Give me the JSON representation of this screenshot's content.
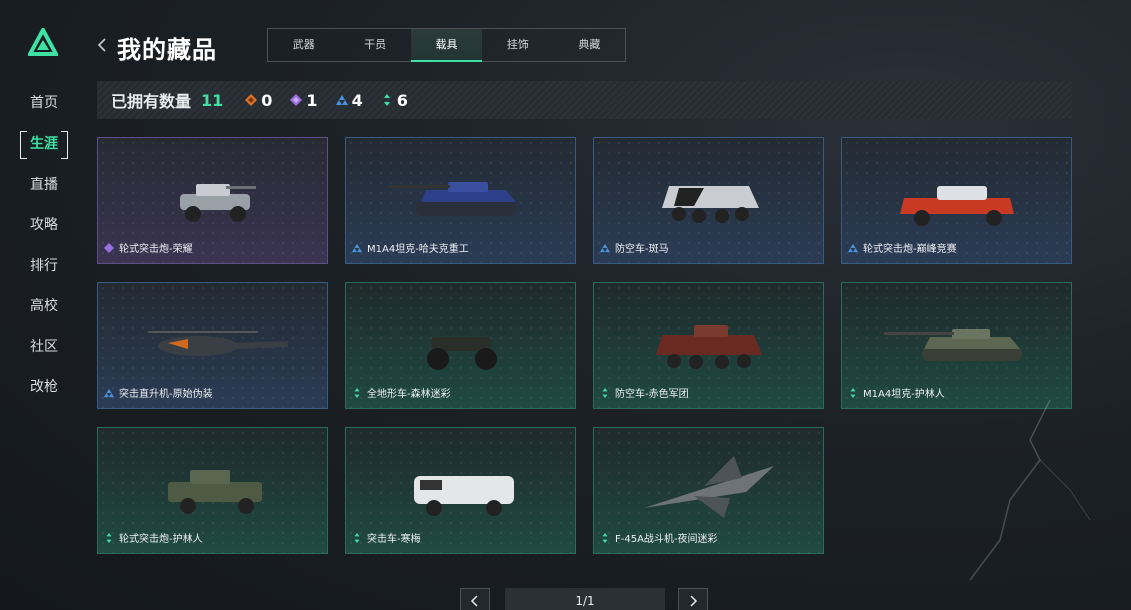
{
  "sidebar": {
    "items": [
      {
        "label": "首页",
        "active": false
      },
      {
        "label": "生涯",
        "active": true
      },
      {
        "label": "直播",
        "active": false
      },
      {
        "label": "攻略",
        "active": false
      },
      {
        "label": "排行",
        "active": false
      },
      {
        "label": "高校",
        "active": false
      },
      {
        "label": "社区",
        "active": false
      },
      {
        "label": "改枪",
        "active": false
      }
    ]
  },
  "header": {
    "back_icon": "chevron-left-icon",
    "title": "我的藏品",
    "tabs": [
      {
        "label": "武器",
        "active": false
      },
      {
        "label": "干员",
        "active": false
      },
      {
        "label": "载具",
        "active": true
      },
      {
        "label": "挂饰",
        "active": false
      },
      {
        "label": "典藏",
        "active": false
      }
    ]
  },
  "stats": {
    "label": "已拥有数量",
    "total": "11",
    "rarities": [
      {
        "name": "orange",
        "color": "#e0732a",
        "count": "0"
      },
      {
        "name": "purple",
        "color": "#9b6ee0",
        "count": "1"
      },
      {
        "name": "blue",
        "color": "#4a92e0",
        "count": "4"
      },
      {
        "name": "green",
        "color": "#3fe0a3",
        "count": "6"
      }
    ]
  },
  "items": [
    {
      "name": "轮式突击炮-荣耀",
      "rarity": "purple",
      "vehicle": "armored-car"
    },
    {
      "name": "M1A4坦克-哈夫克重工",
      "rarity": "blue",
      "vehicle": "tank"
    },
    {
      "name": "防空车-斑马",
      "rarity": "blue",
      "vehicle": "apc"
    },
    {
      "name": "轮式突击炮-巅峰竞赛",
      "rarity": "blue",
      "vehicle": "armored-car"
    },
    {
      "name": "突击直升机-原始伪装",
      "rarity": "blue",
      "vehicle": "helicopter"
    },
    {
      "name": "全地形车-森林迷彩",
      "rarity": "green",
      "vehicle": "atv"
    },
    {
      "name": "防空车-赤色军团",
      "rarity": "green",
      "vehicle": "apc"
    },
    {
      "name": "M1A4坦克-护林人",
      "rarity": "green",
      "vehicle": "tank"
    },
    {
      "name": "轮式突击炮-护林人",
      "rarity": "green",
      "vehicle": "armored-car"
    },
    {
      "name": "突击车-寒梅",
      "rarity": "green",
      "vehicle": "truck"
    },
    {
      "name": "F-45A战斗机-夜间迷彩",
      "rarity": "green",
      "vehicle": "jet"
    }
  ],
  "pager": {
    "prev_icon": "chevron-left-icon",
    "page": "1/1",
    "next_icon": "chevron-right-icon"
  },
  "colors": {
    "accent": "#3fe0a3",
    "purple": "#9b6ee0",
    "blue": "#4a92e0",
    "green": "#3fe0a3"
  }
}
